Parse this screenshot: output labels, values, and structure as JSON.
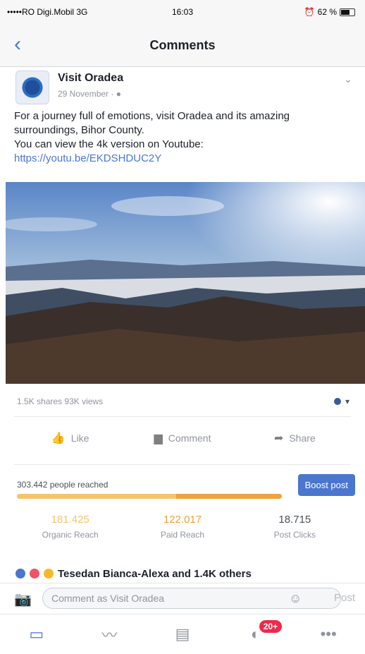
{
  "status": {
    "carrier": "•••••RO Digi.Mobil 3G",
    "time": "16:03",
    "battery": "62 %"
  },
  "nav": {
    "title": "Comments",
    "back_icon": "chevron-left-icon"
  },
  "post": {
    "page_name": "Visit Oradea",
    "date": "29 November · ",
    "text_1": "For a journey full of emotions, visit Oradea and its amazing surroundings, Bihor County.",
    "text_2": " You can view the 4k version on Youtube: ",
    "link": "https://youtu.be/EKDSHDUC2Y"
  },
  "stats": {
    "shares": "1.5K shares",
    "views": "93K views"
  },
  "actions": {
    "like": "Like",
    "comment": "Comment",
    "share": "Share"
  },
  "insights": {
    "reach_label": "303.442 people reached",
    "boost_label": "Boost post",
    "organic_fraction": 0.6,
    "paid_fraction": 0.4,
    "organic_value": "181.425",
    "organic_label": "Organic Reach",
    "paid_value": "122.017",
    "paid_label": "Paid Reach",
    "clicks_value": "18.715",
    "clicks_label": "Post Clicks"
  },
  "reactions": {
    "text": "Tesedan Bianca-Alexa and 1.4K others"
  },
  "composer": {
    "placeholder": "Comment as Visit Oradea",
    "post_label": "Post"
  },
  "tabs": {
    "badge": "20+"
  },
  "colors": {
    "accent": "#4a76d0",
    "organic": "#f6c36d",
    "paid": "#f0a23c"
  }
}
